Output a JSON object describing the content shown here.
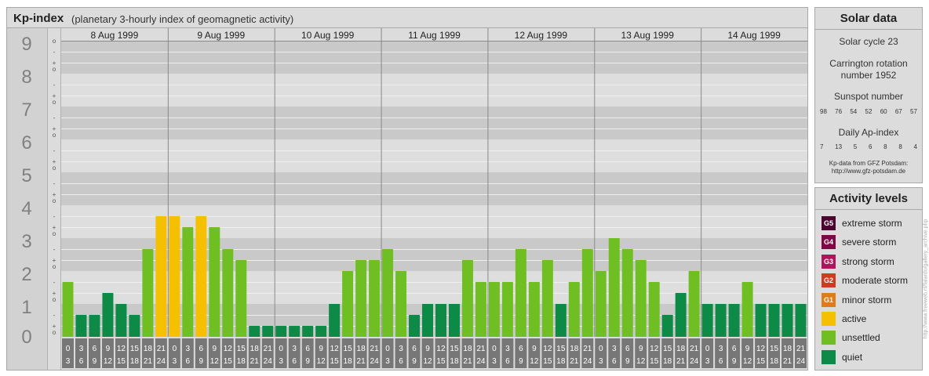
{
  "header": {
    "title": "Kp-index",
    "subtitle": "(planetary 3-hourly index of geomagnetic activity)"
  },
  "chart_data": {
    "type": "bar",
    "title": "Kp-index",
    "ylim": [
      0,
      9
    ],
    "y_ticks": [
      "0",
      "1",
      "2",
      "3",
      "4",
      "5",
      "6",
      "7",
      "8",
      "9"
    ],
    "sub_ticks": [
      "o",
      "+",
      "-"
    ],
    "days": [
      "8 Aug 1999",
      "9 Aug 1999",
      "10 Aug 1999",
      "11 Aug 1999",
      "12 Aug 1999",
      "13 Aug 1999",
      "14 Aug 1999"
    ],
    "slot_top": [
      "0",
      "3",
      "6",
      "9",
      "12",
      "15",
      "18",
      "21"
    ],
    "slot_bottom": [
      "3",
      "6",
      "9",
      "12",
      "15",
      "18",
      "21",
      "24"
    ],
    "values": [
      [
        1.667,
        0.667,
        0.667,
        1.333,
        1.0,
        0.667,
        2.667,
        3.667
      ],
      [
        3.667,
        3.333,
        3.667,
        3.333,
        2.667,
        2.333,
        0.333,
        0.333
      ],
      [
        0.333,
        0.333,
        0.333,
        0.333,
        1.0,
        2.0,
        2.333,
        2.333
      ],
      [
        2.667,
        2.0,
        0.667,
        1.0,
        1.0,
        1.0,
        2.333,
        1.667
      ],
      [
        1.667,
        1.667,
        2.667,
        1.667,
        2.333,
        1.0,
        1.667,
        2.667
      ],
      [
        2.0,
        3.0,
        2.667,
        2.333,
        1.667,
        0.667,
        1.333,
        2.0
      ],
      [
        1.0,
        1.0,
        1.0,
        1.667,
        1.0,
        1.0,
        1.0,
        1.0
      ]
    ],
    "colors": {
      "quiet": "#0c8a46",
      "unsettled": "#6fbf22",
      "active": "#f5c000",
      "minor_storm": "#e07b1a",
      "moderate_storm": "#d03a1f",
      "strong_storm": "#b2145c",
      "severe_storm": "#7d0a47",
      "extreme_storm": "#4a0530"
    }
  },
  "solar": {
    "heading": "Solar data",
    "cycle": "Solar cycle 23",
    "carrington_line1": "Carrington rotation",
    "carrington_line2": "number 1952",
    "sunspot_label": "Sunspot number",
    "sunspot_values": [
      "98",
      "76",
      "54",
      "52",
      "60",
      "67",
      "57"
    ],
    "ap_label": "Daily Ap-index",
    "ap_values": [
      "7",
      "13",
      "5",
      "6",
      "8",
      "8",
      "4"
    ],
    "source_line1": "Kp-data from GFZ Potsdam:",
    "source_line2": "http://www.gfz-potsdam.de"
  },
  "levels": {
    "heading": "Activity levels",
    "items": [
      {
        "code": "G5",
        "label": "extreme storm",
        "color": "#4a0530"
      },
      {
        "code": "G4",
        "label": "severe storm",
        "color": "#7d0a47"
      },
      {
        "code": "G3",
        "label": "strong storm",
        "color": "#b2145c"
      },
      {
        "code": "G2",
        "label": "moderate storm",
        "color": "#d03a1f"
      },
      {
        "code": "G1",
        "label": "minor storm",
        "color": "#e07b1a"
      },
      {
        "code": "",
        "label": "active",
        "color": "#f5c000"
      },
      {
        "code": "",
        "label": "unsettled",
        "color": "#6fbf22"
      },
      {
        "code": "",
        "label": "quiet",
        "color": "#0c8a46"
      }
    ]
  },
  "credit": "http://www.freeweb.nl/falardo/gallery_archive.php"
}
